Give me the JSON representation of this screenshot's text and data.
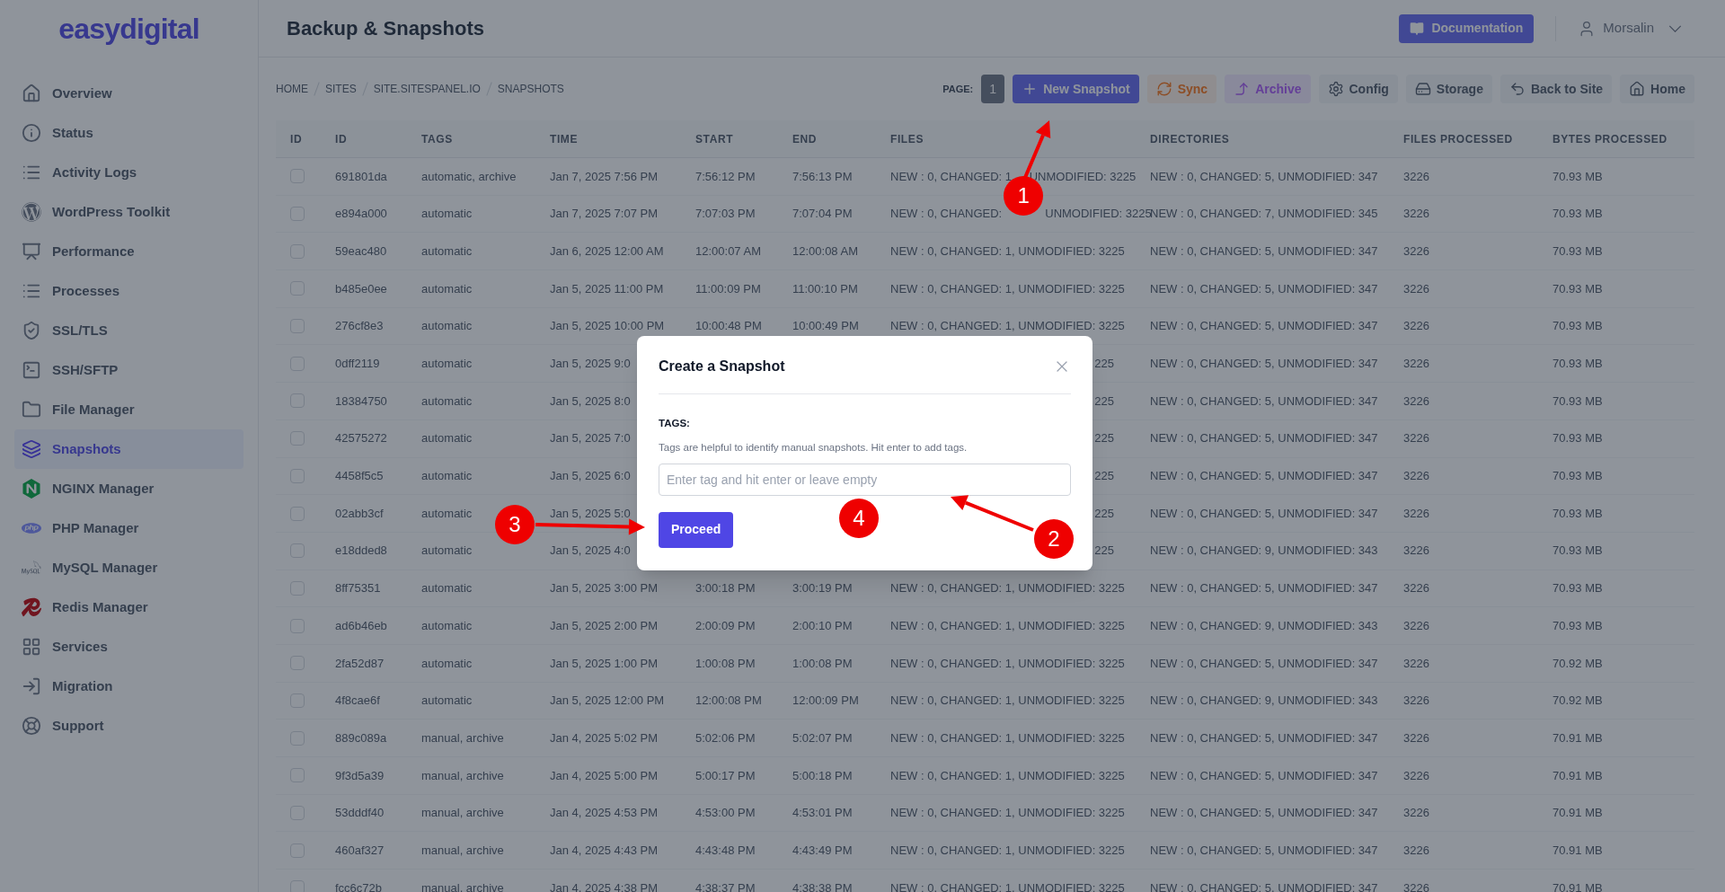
{
  "sidebar": {
    "logo": "easydigital",
    "items": [
      {
        "label": "Overview",
        "selected": false
      },
      {
        "label": "Status",
        "selected": false
      },
      {
        "label": "Activity Logs",
        "selected": false
      },
      {
        "label": "WordPress Toolkit",
        "selected": false
      },
      {
        "label": "Performance",
        "selected": false
      },
      {
        "label": "Processes",
        "selected": false
      },
      {
        "label": "SSL/TLS",
        "selected": false
      },
      {
        "label": "SSH/SFTP",
        "selected": false
      },
      {
        "label": "File Manager",
        "selected": false
      },
      {
        "label": "Snapshots",
        "selected": true
      },
      {
        "label": "NGINX Manager",
        "selected": false
      },
      {
        "label": "PHP Manager",
        "selected": false
      },
      {
        "label": "MySQL Manager",
        "selected": false
      },
      {
        "label": "Redis Manager",
        "selected": false
      },
      {
        "label": "Services",
        "selected": false
      },
      {
        "label": "Migration",
        "selected": false
      },
      {
        "label": "Support",
        "selected": false
      }
    ]
  },
  "header": {
    "title": "Backup & Snapshots",
    "documentation_button": "Documentation",
    "user": "Morsalin"
  },
  "breadcrumb": [
    "HOME",
    "SITES",
    "SITE.SITESPANEL.IO",
    "SNAPSHOTS"
  ],
  "toolbar": {
    "page_label": "PAGE:",
    "page": "1",
    "buttons": [
      {
        "label": "New Snapshot",
        "kind": "primary"
      },
      {
        "label": "Sync",
        "kind": "warning"
      },
      {
        "label": "Archive",
        "kind": "accent"
      },
      {
        "label": "Config",
        "kind": "plain"
      },
      {
        "label": "Storage",
        "kind": "plain"
      },
      {
        "label": "Back to Site",
        "kind": "plain"
      },
      {
        "label": "Home",
        "kind": "plain"
      }
    ]
  },
  "table": {
    "columns": [
      "ID",
      "ID",
      "TAGS",
      "TIME",
      "START",
      "END",
      "FILES",
      "DIRECTORIES",
      "FILES PROCESSED",
      "BYTES PROCESSED"
    ],
    "rows": [
      {
        "checked": false,
        "id": "691801da",
        "tags": "automatic, archive",
        "time": "Jan 7, 2025 7:56 PM",
        "start": "7:56:12 PM",
        "end": "7:56:13 PM",
        "files": "NEW : 0, CHANGED: 1,",
        "files_after": "UNMODIFIED: 3225",
        "directories": "NEW : 0, CHANGED: 5, UNMODIFIED: 347",
        "files_processed": "3226",
        "bytes_processed": "70.93 MB"
      },
      {
        "checked": false,
        "id": "e894a000",
        "tags": "automatic",
        "time": "Jan 7, 2025 7:07 PM",
        "start": "7:07:03 PM",
        "end": "7:07:04 PM",
        "files": "NEW : 0, CHANGED:",
        "files_after": "UNMODIFIED: 3225",
        "directories": "NEW : 0, CHANGED: 7, UNMODIFIED: 345",
        "files_processed": "3226",
        "bytes_processed": "70.93 MB"
      },
      {
        "checked": false,
        "id": "59eac480",
        "tags": "automatic",
        "time": "Jan 6, 2025 12:00 AM",
        "start": "12:00:07 AM",
        "end": "12:00:08 AM",
        "files": "NEW : 0, CHANGED: 1, UNMODIFIED: 3225",
        "directories": "NEW : 0, CHANGED: 5, UNMODIFIED: 347",
        "files_processed": "3226",
        "bytes_processed": "70.93 MB"
      },
      {
        "checked": false,
        "id": "b485e0ee",
        "tags": "automatic",
        "time": "Jan 5, 2025 11:00 PM",
        "start": "11:00:09 PM",
        "end": "11:00:10 PM",
        "files": "NEW : 0, CHANGED: 1, UNMODIFIED: 3225",
        "directories": "NEW : 0, CHANGED: 5, UNMODIFIED: 347",
        "files_processed": "3226",
        "bytes_processed": "70.93 MB"
      },
      {
        "checked": false,
        "id": "276cf8e3",
        "tags": "automatic",
        "time": "Jan 5, 2025 10:00 PM",
        "start": "10:00:48 PM",
        "end": "10:00:49 PM",
        "files": "NEW : 0, CHANGED: 1, UNMODIFIED: 3225",
        "directories": "NEW : 0, CHANGED: 5, UNMODIFIED: 347",
        "files_processed": "3226",
        "bytes_processed": "70.93 MB"
      },
      {
        "checked": false,
        "id": "0dff2119",
        "tags": "automatic",
        "time": "Jan 5, 2025 9:0",
        "files": "225",
        "directories": "NEW : 0, CHANGED: 5, UNMODIFIED: 347",
        "files_processed": "3226",
        "bytes_processed": "70.93 MB"
      },
      {
        "checked": false,
        "id": "18384750",
        "tags": "automatic",
        "time": "Jan 5, 2025 8:0",
        "files": "225",
        "directories": "NEW : 0, CHANGED: 5, UNMODIFIED: 347",
        "files_processed": "3226",
        "bytes_processed": "70.93 MB"
      },
      {
        "checked": false,
        "id": "42575272",
        "tags": "automatic",
        "time": "Jan 5, 2025 7:0",
        "files": "225",
        "directories": "NEW : 0, CHANGED: 5, UNMODIFIED: 347",
        "files_processed": "3226",
        "bytes_processed": "70.93 MB"
      },
      {
        "checked": false,
        "id": "4458f5c5",
        "tags": "automatic",
        "time": "Jan 5, 2025 6:0",
        "files": "225",
        "directories": "NEW : 0, CHANGED: 5, UNMODIFIED: 347",
        "files_processed": "3226",
        "bytes_processed": "70.93 MB"
      },
      {
        "checked": false,
        "id": "02abb3cf",
        "tags": "automatic",
        "time": "Jan 5, 2025 5:0",
        "files": "225",
        "directories": "NEW : 0, CHANGED: 5, UNMODIFIED: 347",
        "files_processed": "3226",
        "bytes_processed": "70.93 MB"
      },
      {
        "checked": false,
        "id": "e18dded8",
        "tags": "automatic",
        "time": "Jan 5, 2025 4:0",
        "files": "225",
        "directories": "NEW : 0, CHANGED: 9, UNMODIFIED: 343",
        "files_processed": "3226",
        "bytes_processed": "70.93 MB"
      },
      {
        "checked": false,
        "id": "8ff75351",
        "tags": "automatic",
        "time": "Jan 5, 2025 3:00 PM",
        "start": "3:00:18 PM",
        "end": "3:00:19 PM",
        "files": "NEW : 0, CHANGED: 1, UNMODIFIED: 3225",
        "directories": "NEW : 0, CHANGED: 5, UNMODIFIED: 347",
        "files_processed": "3226",
        "bytes_processed": "70.93 MB"
      },
      {
        "checked": false,
        "id": "ad6b46eb",
        "tags": "automatic",
        "time": "Jan 5, 2025 2:00 PM",
        "start": "2:00:09 PM",
        "end": "2:00:10 PM",
        "files": "NEW : 0, CHANGED: 1, UNMODIFIED: 3225",
        "directories": "NEW : 0, CHANGED: 9, UNMODIFIED: 343",
        "files_processed": "3226",
        "bytes_processed": "70.93 MB"
      },
      {
        "checked": false,
        "id": "2fa52d87",
        "tags": "automatic",
        "time": "Jan 5, 2025 1:00 PM",
        "start": "1:00:08 PM",
        "end": "1:00:08 PM",
        "files": "NEW : 0, CHANGED: 1, UNMODIFIED: 3225",
        "directories": "NEW : 0, CHANGED: 5, UNMODIFIED: 347",
        "files_processed": "3226",
        "bytes_processed": "70.92 MB"
      },
      {
        "checked": false,
        "id": "4f8cae6f",
        "tags": "automatic",
        "time": "Jan 5, 2025 12:00 PM",
        "start": "12:00:08 PM",
        "end": "12:00:09 PM",
        "files": "NEW : 0, CHANGED: 1, UNMODIFIED: 3225",
        "directories": "NEW : 0, CHANGED: 9, UNMODIFIED: 343",
        "files_processed": "3226",
        "bytes_processed": "70.92 MB"
      },
      {
        "checked": false,
        "id": "889c089a",
        "tags": "manual, archive",
        "time": "Jan 4, 2025 5:02 PM",
        "start": "5:02:06 PM",
        "end": "5:02:07 PM",
        "files": "NEW : 0, CHANGED: 1, UNMODIFIED: 3225",
        "directories": "NEW : 0, CHANGED: 5, UNMODIFIED: 347",
        "files_processed": "3226",
        "bytes_processed": "70.91 MB"
      },
      {
        "checked": false,
        "id": "9f3d5a39",
        "tags": "manual, archive",
        "time": "Jan 4, 2025 5:00 PM",
        "start": "5:00:17 PM",
        "end": "5:00:18 PM",
        "files": "NEW : 0, CHANGED: 1, UNMODIFIED: 3225",
        "directories": "NEW : 0, CHANGED: 5, UNMODIFIED: 347",
        "files_processed": "3226",
        "bytes_processed": "70.91 MB"
      },
      {
        "checked": false,
        "id": "53dddf40",
        "tags": "manual, archive",
        "time": "Jan 4, 2025 4:53 PM",
        "start": "4:53:00 PM",
        "end": "4:53:01 PM",
        "files": "NEW : 0, CHANGED: 1, UNMODIFIED: 3225",
        "directories": "NEW : 0, CHANGED: 5, UNMODIFIED: 347",
        "files_processed": "3226",
        "bytes_processed": "70.91 MB"
      },
      {
        "checked": false,
        "id": "460af327",
        "tags": "manual, archive",
        "time": "Jan 4, 2025 4:43 PM",
        "start": "4:43:48 PM",
        "end": "4:43:49 PM",
        "files": "NEW : 0, CHANGED: 1, UNMODIFIED: 3225",
        "directories": "NEW : 0, CHANGED: 5, UNMODIFIED: 347",
        "files_processed": "3226",
        "bytes_processed": "70.91 MB"
      },
      {
        "checked": false,
        "id": "fcc6c72b",
        "tags": "manual, archive",
        "time": "Jan 4, 2025 4:38 PM",
        "start": "4:38:37 PM",
        "end": "4:38:38 PM",
        "files": "NEW : 0, CHANGED: 1, UNMODIFIED: 3225",
        "directories": "NEW : 0, CHANGED: 5, UNMODIFIED: 347",
        "files_processed": "3226",
        "bytes_processed": "70.91 MB"
      }
    ]
  },
  "modal": {
    "title": "Create a Snapshot",
    "field_label": "TAGS:",
    "help": "Tags are helpful to identify manual snapshots. Hit enter to add tags.",
    "placeholder": "Enter tag and hit enter or leave empty",
    "button": "Proceed"
  },
  "annotations": [
    {
      "label": "1"
    },
    {
      "label": "2"
    },
    {
      "label": "3"
    },
    {
      "label": "4"
    }
  ]
}
